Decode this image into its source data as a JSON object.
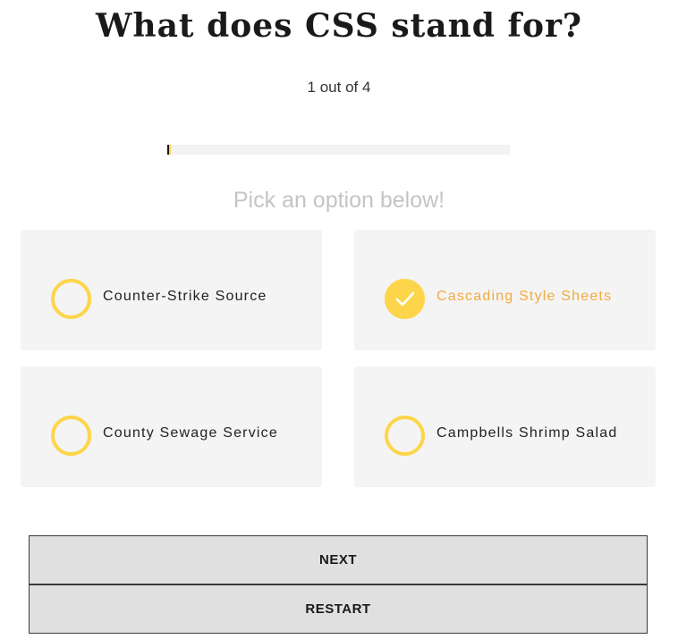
{
  "quiz": {
    "question": "What does CSS stand for?",
    "counter": "1 out of 4",
    "progress_fraction": 0.01,
    "prompt": "Pick an option below!"
  },
  "options": [
    {
      "label": "Counter-Strike Source",
      "selected": false
    },
    {
      "label": "Cascading Style Sheets",
      "selected": true
    },
    {
      "label": "County Sewage Service",
      "selected": false
    },
    {
      "label": "Campbells Shrimp Salad",
      "selected": false
    }
  ],
  "buttons": {
    "next_label": "NEXT",
    "restart_label": "RESTART"
  },
  "colors": {
    "accent": "#fdd54a",
    "selected_text": "#f2aa3f",
    "card_bg": "#f4f4f4",
    "prompt_text": "#c4c4c4"
  },
  "icons": {
    "unchecked": "radio-circle-icon",
    "checked": "checkmark-icon"
  }
}
